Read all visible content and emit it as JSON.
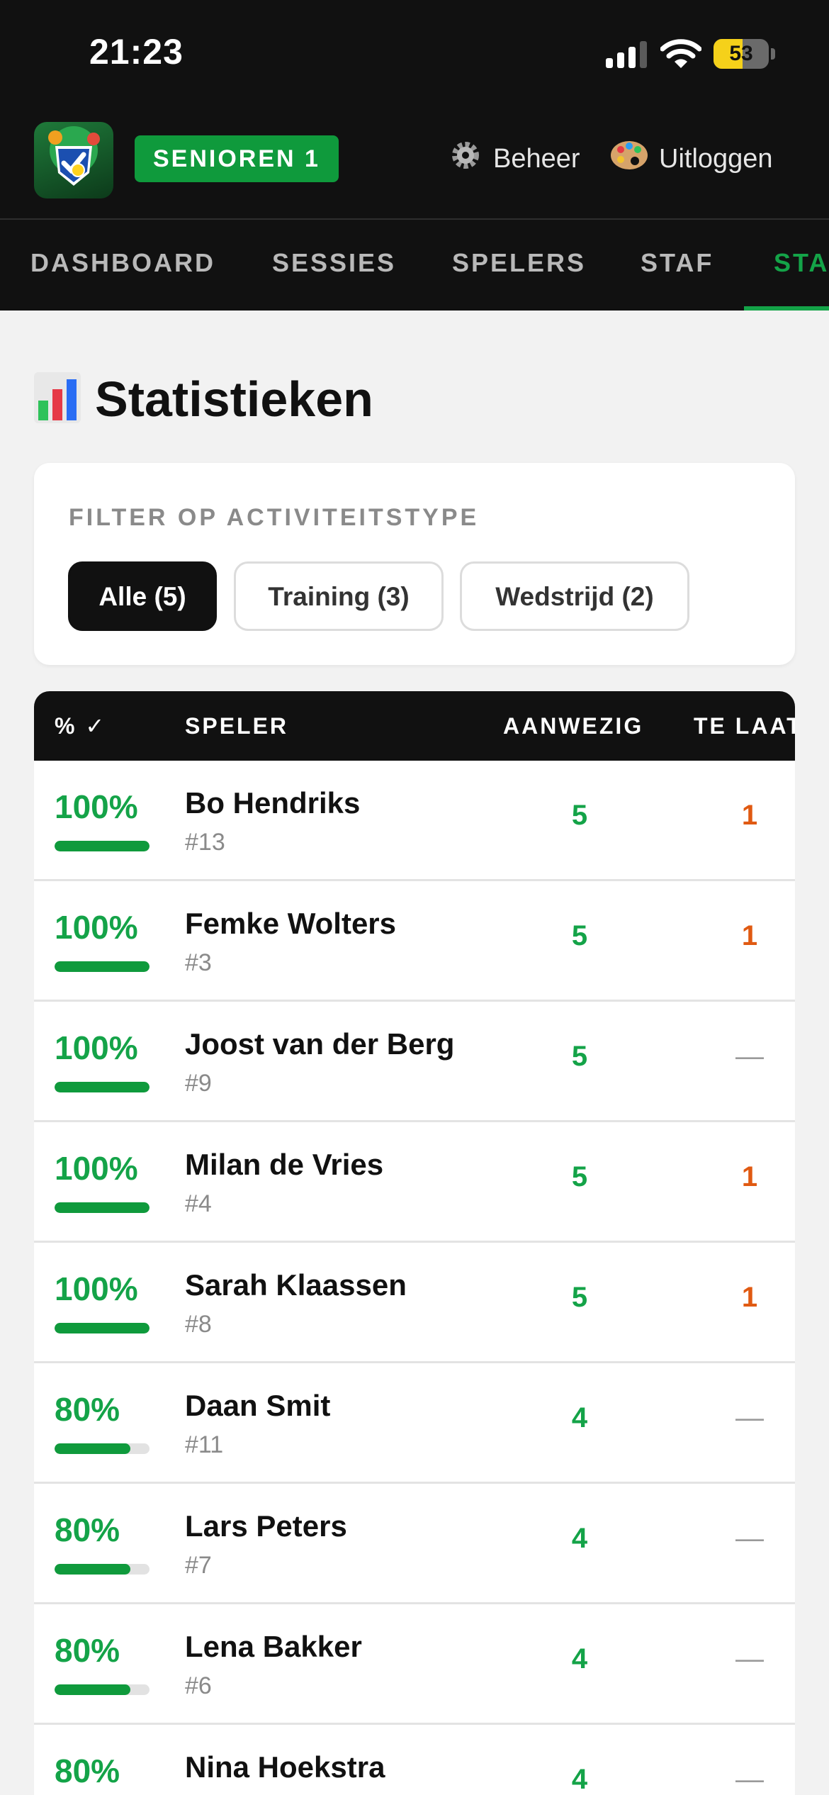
{
  "status_bar": {
    "time": "21:23",
    "battery": "53",
    "battery_level": 0.53
  },
  "header": {
    "team_badge": "SENIOREN 1",
    "admin_label": "Beheer",
    "logout_label": "Uitloggen",
    "icons": {
      "admin": "gear-icon",
      "logout": "palette-icon"
    }
  },
  "tabs": [
    {
      "label": "DASHBOARD",
      "active": false
    },
    {
      "label": "SESSIES",
      "active": false
    },
    {
      "label": "SPELERS",
      "active": false
    },
    {
      "label": "STAF",
      "active": false
    },
    {
      "label": "STA",
      "active": true
    }
  ],
  "page": {
    "title": "Statistieken",
    "icon": "bar-chart-icon"
  },
  "filter": {
    "label": "FILTER OP ACTIVITEITSTYPE",
    "chips": [
      {
        "label": "Alle (5)",
        "active": true
      },
      {
        "label": "Training (3)",
        "active": false
      },
      {
        "label": "Wedstrijd (2)",
        "active": false
      }
    ]
  },
  "table": {
    "headers": {
      "pct": "% ✓",
      "player": "SPELER",
      "present": "AANWEZIG",
      "late": "TE LAAT"
    },
    "rows": [
      {
        "pct": "100%",
        "fraction": 1.0,
        "name": "Bo Hendriks",
        "number": "#13",
        "present": "5",
        "late": "1"
      },
      {
        "pct": "100%",
        "fraction": 1.0,
        "name": "Femke Wolters",
        "number": "#3",
        "present": "5",
        "late": "1"
      },
      {
        "pct": "100%",
        "fraction": 1.0,
        "name": "Joost van der Berg",
        "number": "#9",
        "present": "5",
        "late": "—"
      },
      {
        "pct": "100%",
        "fraction": 1.0,
        "name": "Milan de Vries",
        "number": "#4",
        "present": "5",
        "late": "1"
      },
      {
        "pct": "100%",
        "fraction": 1.0,
        "name": "Sarah Klaassen",
        "number": "#8",
        "present": "5",
        "late": "1"
      },
      {
        "pct": "80%",
        "fraction": 0.8,
        "name": "Daan Smit",
        "number": "#11",
        "present": "4",
        "late": "—"
      },
      {
        "pct": "80%",
        "fraction": 0.8,
        "name": "Lars Peters",
        "number": "#7",
        "present": "4",
        "late": "—"
      },
      {
        "pct": "80%",
        "fraction": 0.8,
        "name": "Lena Bakker",
        "number": "#6",
        "present": "4",
        "late": "—"
      },
      {
        "pct": "80%",
        "fraction": 0.8,
        "name": "Nina Hoekstra",
        "number": "",
        "present": "4",
        "late": "—"
      }
    ]
  },
  "colors": {
    "brand_green": "#14a348",
    "late_orange": "#e05a12",
    "header_dark": "#111111",
    "battery_yellow": "#f5d11a"
  }
}
